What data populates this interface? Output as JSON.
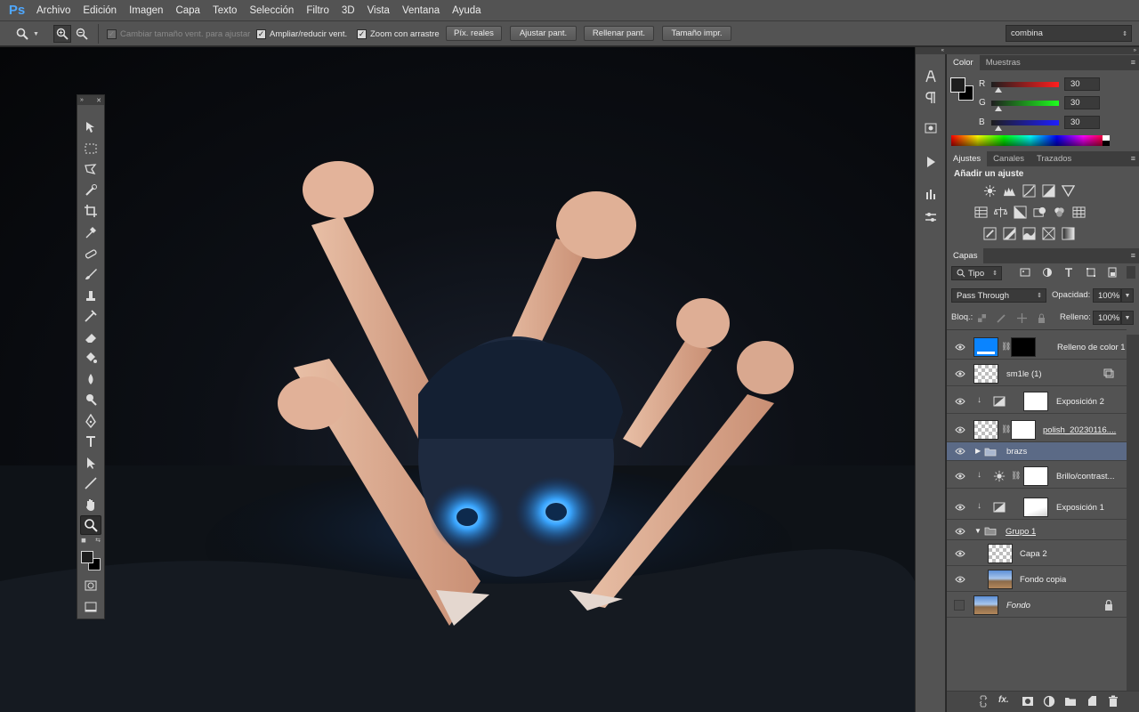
{
  "app": {
    "logo": "Ps"
  },
  "menu": [
    "Archivo",
    "Edición",
    "Imagen",
    "Capa",
    "Texto",
    "Selección",
    "Filtro",
    "3D",
    "Vista",
    "Ventana",
    "Ayuda"
  ],
  "options": {
    "resize_windows": "Cambiar tamaño vent. para ajustar",
    "zoom_all": "Ampliar/reducir vent.",
    "scrubby_zoom": "Zoom con arrastre",
    "actual_pixels": "Píx. reales",
    "fit_screen": "Ajustar pant.",
    "fill_screen": "Rellenar pant.",
    "print_size": "Tamaño impr.",
    "workspace": "combina"
  },
  "color_panel": {
    "tabs": [
      "Color",
      "Muestras"
    ],
    "r_label": "R",
    "g_label": "G",
    "b_label": "B",
    "r": "30",
    "g": "30",
    "b": "30"
  },
  "adjust_panel": {
    "tabs": [
      "Ajustes",
      "Canales",
      "Trazados"
    ],
    "title": "Añadir un ajuste"
  },
  "layers_panel": {
    "tab": "Capas",
    "filter": "Tipo",
    "blend_mode": "Pass Through",
    "opacity_label": "Opacidad:",
    "opacity": "100%",
    "lock_label": "Bloq.:",
    "fill_label": "Relleno:",
    "fill": "100%",
    "layers": [
      {
        "name": "Relleno de color 1"
      },
      {
        "name": "sm1le (1)"
      },
      {
        "name": "Exposición 2"
      },
      {
        "name": "polish_20230116...."
      },
      {
        "name": "brazs"
      },
      {
        "name": "Brillo/contrast..."
      },
      {
        "name": "Exposición 1"
      },
      {
        "name": "Grupo 1"
      },
      {
        "name": "Capa 2"
      },
      {
        "name": "Fondo copia"
      },
      {
        "name": "Fondo"
      }
    ]
  },
  "colors": {
    "accent_blue": "#0a84ff",
    "selected_layer": "#5b6a86",
    "glow": "#3aa6ff"
  }
}
